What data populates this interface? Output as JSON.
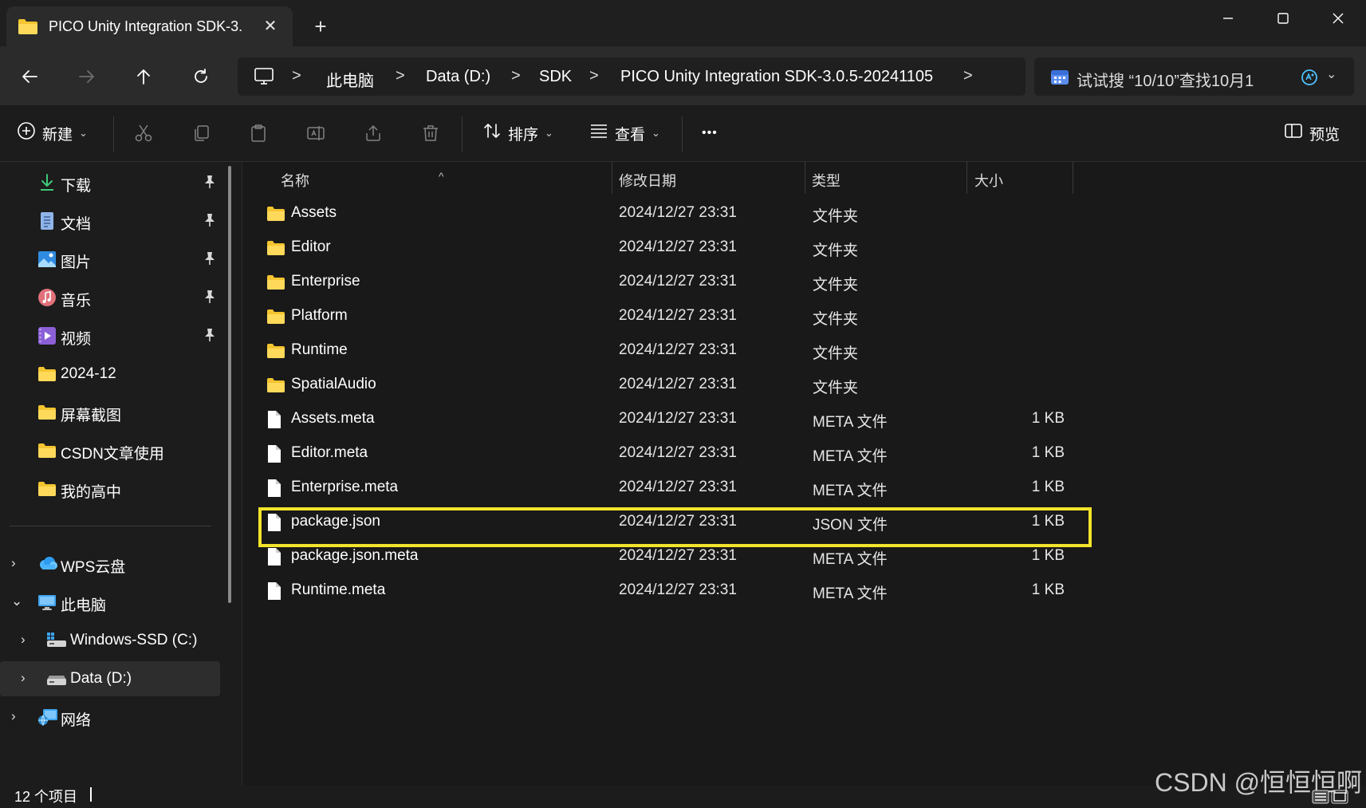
{
  "tab": {
    "title": "PICO Unity Integration SDK-3.",
    "close_glyph": "✕",
    "new_tab_glyph": "+"
  },
  "nav": {
    "breadcrumbs": [
      "此电脑",
      "Data (D:)",
      "SDK",
      "PICO Unity Integration SDK-3.0.5-20241105"
    ],
    "separator": ">"
  },
  "search": {
    "placeholder": "试试搜 “10/10”查找10月1",
    "chevron": "⌄"
  },
  "commandbar": {
    "new_label": "新建",
    "sort_label": "排序",
    "view_label": "查看",
    "more_label": "•••",
    "preview_label": "预览"
  },
  "sidebar": {
    "quick": [
      {
        "label": "下载",
        "icon": "download-icon",
        "pinned": true
      },
      {
        "label": "文档",
        "icon": "document-icon",
        "pinned": true
      },
      {
        "label": "图片",
        "icon": "pictures-icon",
        "pinned": true
      },
      {
        "label": "音乐",
        "icon": "music-icon",
        "pinned": true
      },
      {
        "label": "视频",
        "icon": "video-icon",
        "pinned": true
      },
      {
        "label": "2024-12",
        "icon": "folder-icon",
        "pinned": false
      },
      {
        "label": "屏幕截图",
        "icon": "folder-icon",
        "pinned": false
      },
      {
        "label": "CSDN文章使用",
        "icon": "folder-icon",
        "pinned": false
      },
      {
        "label": "我的高中",
        "icon": "folder-icon",
        "pinned": false
      }
    ],
    "tree": [
      {
        "label": "WPS云盘",
        "icon": "cloud-icon",
        "chevron": "›"
      },
      {
        "label": "此电脑",
        "icon": "computer-icon",
        "chevron": "⌄"
      },
      {
        "label": "Windows-SSD (C:)",
        "icon": "drive-c-icon",
        "chevron": "›"
      },
      {
        "label": "Data (D:)",
        "icon": "drive-d-icon",
        "chevron": "›"
      },
      {
        "label": "网络",
        "icon": "network-icon",
        "chevron": "›"
      }
    ]
  },
  "columns": {
    "name": "名称",
    "modified": "修改日期",
    "type": "类型",
    "size": "大小"
  },
  "files": [
    {
      "name": "Assets",
      "date": "2024/12/27 23:31",
      "type": "文件夹",
      "size": "",
      "kind": "folder"
    },
    {
      "name": "Editor",
      "date": "2024/12/27 23:31",
      "type": "文件夹",
      "size": "",
      "kind": "folder"
    },
    {
      "name": "Enterprise",
      "date": "2024/12/27 23:31",
      "type": "文件夹",
      "size": "",
      "kind": "folder"
    },
    {
      "name": "Platform",
      "date": "2024/12/27 23:31",
      "type": "文件夹",
      "size": "",
      "kind": "folder"
    },
    {
      "name": "Runtime",
      "date": "2024/12/27 23:31",
      "type": "文件夹",
      "size": "",
      "kind": "folder"
    },
    {
      "name": "SpatialAudio",
      "date": "2024/12/27 23:31",
      "type": "文件夹",
      "size": "",
      "kind": "folder"
    },
    {
      "name": "Assets.meta",
      "date": "2024/12/27 23:31",
      "type": "META 文件",
      "size": "1 KB",
      "kind": "file"
    },
    {
      "name": "Editor.meta",
      "date": "2024/12/27 23:31",
      "type": "META 文件",
      "size": "1 KB",
      "kind": "file"
    },
    {
      "name": "Enterprise.meta",
      "date": "2024/12/27 23:31",
      "type": "META 文件",
      "size": "1 KB",
      "kind": "file"
    },
    {
      "name": "package.json",
      "date": "2024/12/27 23:31",
      "type": "JSON 文件",
      "size": "1 KB",
      "kind": "file"
    },
    {
      "name": "package.json.meta",
      "date": "2024/12/27 23:31",
      "type": "META 文件",
      "size": "1 KB",
      "kind": "file"
    },
    {
      "name": "Runtime.meta",
      "date": "2024/12/27 23:31",
      "type": "META 文件",
      "size": "1 KB",
      "kind": "file"
    }
  ],
  "highlight_color": "#f2e42a",
  "status": {
    "item_count": "12 个项目"
  },
  "watermark": "CSDN @恒恒恒啊"
}
